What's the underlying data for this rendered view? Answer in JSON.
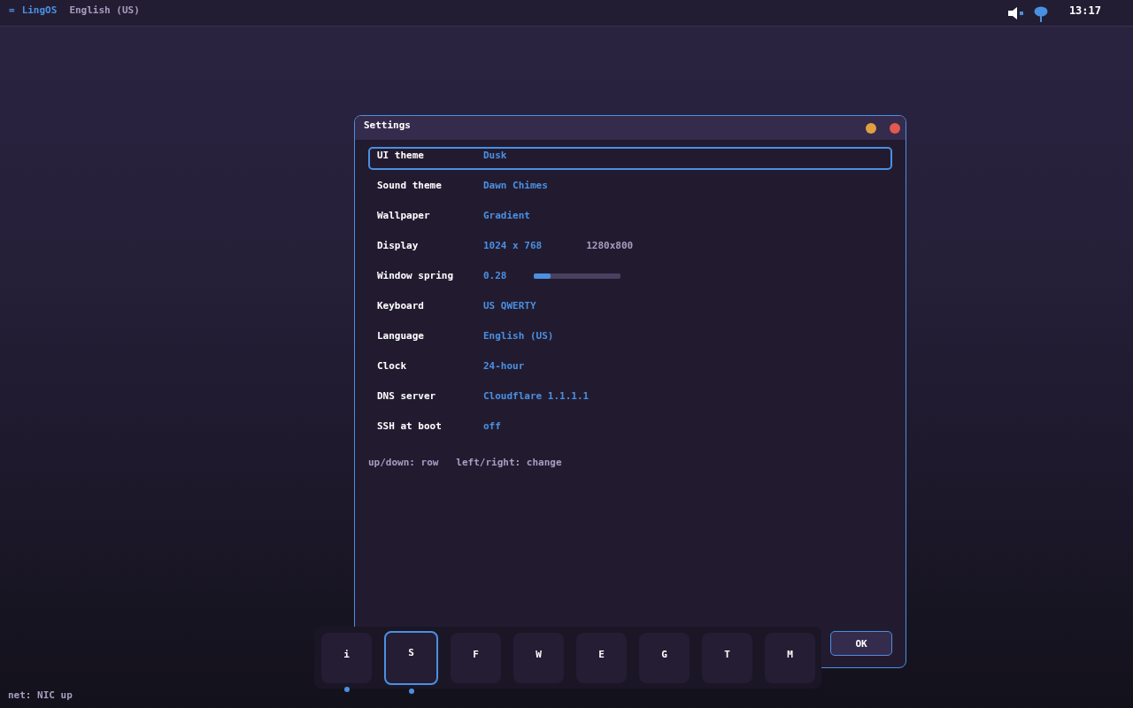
{
  "top_bar": {
    "menu_glyph": "=",
    "brand": "LingOS",
    "locale": "English (US)",
    "clock": "13:17"
  },
  "window": {
    "title": "Settings",
    "rows": [
      {
        "kind": "text",
        "label": "UI theme",
        "value": "Dusk",
        "selected": true
      },
      {
        "kind": "text",
        "label": "Sound theme",
        "value": "Dawn Chimes",
        "selected": false
      },
      {
        "kind": "text",
        "label": "Wallpaper",
        "value": "Gradient",
        "selected": false
      },
      {
        "kind": "note",
        "label": "Display",
        "value": "1024 x 768",
        "note": "1280x800",
        "selected": false
      },
      {
        "kind": "slider",
        "label": "Window spring",
        "value": "0.28",
        "level": 0.2,
        "selected": false
      },
      {
        "kind": "text",
        "label": "Keyboard",
        "value": "US QWERTY",
        "selected": false
      },
      {
        "kind": "text",
        "label": "Language",
        "value": "English (US)",
        "selected": false
      },
      {
        "kind": "text",
        "label": "Clock",
        "value": "24-hour",
        "selected": false
      },
      {
        "kind": "text",
        "label": "DNS server",
        "value": "Cloudflare 1.1.1.1",
        "selected": false
      },
      {
        "kind": "text",
        "label": "SSH at boot",
        "value": "off",
        "selected": false
      }
    ],
    "hint": "up/down: row   left/right: change",
    "ok_button": "OK"
  },
  "dock": [
    {
      "label": "i",
      "selected": false,
      "running": true
    },
    {
      "label": "S",
      "selected": true,
      "running": true
    },
    {
      "label": "F",
      "selected": false,
      "running": false
    },
    {
      "label": "W",
      "selected": false,
      "running": false
    },
    {
      "label": "E",
      "selected": false,
      "running": false
    },
    {
      "label": "G",
      "selected": false,
      "running": false
    },
    {
      "label": "T",
      "selected": false,
      "running": false
    },
    {
      "label": "M",
      "selected": false,
      "running": false
    }
  ],
  "status": "net: NIC up"
}
